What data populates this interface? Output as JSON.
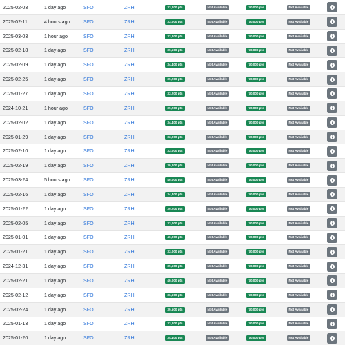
{
  "rows": [
    {
      "date": "2025-02-03",
      "ago": "1 day ago",
      "from": "SFO",
      "to": "ZRH",
      "economy": "33,200 pts",
      "premium": "Not Available",
      "business": "70,000 pts",
      "first": "Not Available"
    },
    {
      "date": "2025-02-11",
      "ago": "4 hours ago",
      "from": "SFO",
      "to": "ZRH",
      "economy": "33,000 pts",
      "premium": "Not Available",
      "business": "70,000 pts",
      "first": "Not Available"
    },
    {
      "date": "2025-03-03",
      "ago": "1 hour ago",
      "from": "SFO",
      "to": "ZRH",
      "economy": "33,200 pts",
      "premium": "Not Available",
      "business": "70,000 pts",
      "first": "Not Available"
    },
    {
      "date": "2025-02-18",
      "ago": "1 day ago",
      "from": "SFO",
      "to": "ZRH",
      "economy": "39,500 pts",
      "premium": "Not Available",
      "business": "70,000 pts",
      "first": "Not Available"
    },
    {
      "date": "2025-02-09",
      "ago": "1 day ago",
      "from": "SFO",
      "to": "ZRH",
      "economy": "34,400 pts",
      "premium": "Not Available",
      "business": "70,000 pts",
      "first": "Not Available"
    },
    {
      "date": "2025-02-25",
      "ago": "1 day ago",
      "from": "SFO",
      "to": "ZRH",
      "economy": "39,200 pts",
      "premium": "Not Available",
      "business": "70,000 pts",
      "first": "Not Available"
    },
    {
      "date": "2025-01-27",
      "ago": "1 day ago",
      "from": "SFO",
      "to": "ZRH",
      "economy": "33,200 pts",
      "premium": "Not Available",
      "business": "70,000 pts",
      "first": "Not Available"
    },
    {
      "date": "2024-10-21",
      "ago": "1 hour ago",
      "from": "SFO",
      "to": "ZRH",
      "economy": "39,200 pts",
      "premium": "Not Available",
      "business": "70,000 pts",
      "first": "Not Available"
    },
    {
      "date": "2025-02-02",
      "ago": "1 day ago",
      "from": "SFO",
      "to": "ZRH",
      "economy": "34,400 pts",
      "premium": "Not Available",
      "business": "70,000 pts",
      "first": "Not Available"
    },
    {
      "date": "2025-01-29",
      "ago": "1 day ago",
      "from": "SFO",
      "to": "ZRH",
      "economy": "33,000 pts",
      "premium": "Not Available",
      "business": "70,000 pts",
      "first": "Not Available"
    },
    {
      "date": "2025-02-10",
      "ago": "1 day ago",
      "from": "SFO",
      "to": "ZRH",
      "economy": "33,000 pts",
      "premium": "Not Available",
      "business": "70,000 pts",
      "first": "Not Available"
    },
    {
      "date": "2025-02-19",
      "ago": "1 day ago",
      "from": "SFO",
      "to": "ZRH",
      "economy": "39,200 pts",
      "premium": "Not Available",
      "business": "70,000 pts",
      "first": "Not Available"
    },
    {
      "date": "2025-03-24",
      "ago": "5 hours ago",
      "from": "SFO",
      "to": "ZRH",
      "economy": "40,000 pts",
      "premium": "Not Available",
      "business": "70,000 pts",
      "first": "Not Available"
    },
    {
      "date": "2025-02-16",
      "ago": "1 day ago",
      "from": "SFO",
      "to": "ZRH",
      "economy": "34,400 pts",
      "premium": "Not Available",
      "business": "70,000 pts",
      "first": "Not Available"
    },
    {
      "date": "2025-01-22",
      "ago": "1 day ago",
      "from": "SFO",
      "to": "ZRH",
      "economy": "39,200 pts",
      "premium": "Not Available",
      "business": "70,000 pts",
      "first": "Not Available"
    },
    {
      "date": "2025-02-05",
      "ago": "1 day ago",
      "from": "SFO",
      "to": "ZRH",
      "economy": "33,000 pts",
      "premium": "Not Available",
      "business": "70,000 pts",
      "first": "Not Available"
    },
    {
      "date": "2025-01-01",
      "ago": "1 day ago",
      "from": "SFO",
      "to": "ZRH",
      "economy": "40,000 pts",
      "premium": "Not Available",
      "business": "70,000 pts",
      "first": "Not Available"
    },
    {
      "date": "2025-01-21",
      "ago": "1 day ago",
      "from": "SFO",
      "to": "ZRH",
      "economy": "33,000 pts",
      "premium": "Not Available",
      "business": "70,000 pts",
      "first": "Not Available"
    },
    {
      "date": "2024-12-31",
      "ago": "1 day ago",
      "from": "SFO",
      "to": "ZRH",
      "economy": "39,500 pts",
      "premium": "Not Available",
      "business": "70,000 pts",
      "first": "Not Available"
    },
    {
      "date": "2025-02-21",
      "ago": "1 day ago",
      "from": "SFO",
      "to": "ZRH",
      "economy": "40,000 pts",
      "premium": "Not Available",
      "business": "70,000 pts",
      "first": "Not Available"
    },
    {
      "date": "2025-02-12",
      "ago": "1 day ago",
      "from": "SFO",
      "to": "ZRH",
      "economy": "36,600 pts",
      "premium": "Not Available",
      "business": "70,000 pts",
      "first": "Not Available"
    },
    {
      "date": "2025-02-24",
      "ago": "1 day ago",
      "from": "SFO",
      "to": "ZRH",
      "economy": "39,500 pts",
      "premium": "Not Available",
      "business": "70,000 pts",
      "first": "Not Available"
    },
    {
      "date": "2025-01-13",
      "ago": "1 day ago",
      "from": "SFO",
      "to": "ZRH",
      "economy": "33,200 pts",
      "premium": "Not Available",
      "business": "70,000 pts",
      "first": "Not Available"
    },
    {
      "date": "2025-01-20",
      "ago": "1 day ago",
      "from": "SFO",
      "to": "ZRH",
      "economy": "34,400 pts",
      "premium": "Not Available",
      "business": "70,000 pts",
      "first": "Not Available"
    }
  ],
  "colors": {
    "available_badge": "#198754",
    "unavailable_badge": "#6c757d",
    "link": "#2a73d9",
    "info_button": "#6c757d",
    "row_stripe": "#f2f2f2"
  },
  "icons": {
    "details_button": "info-circle-icon"
  }
}
